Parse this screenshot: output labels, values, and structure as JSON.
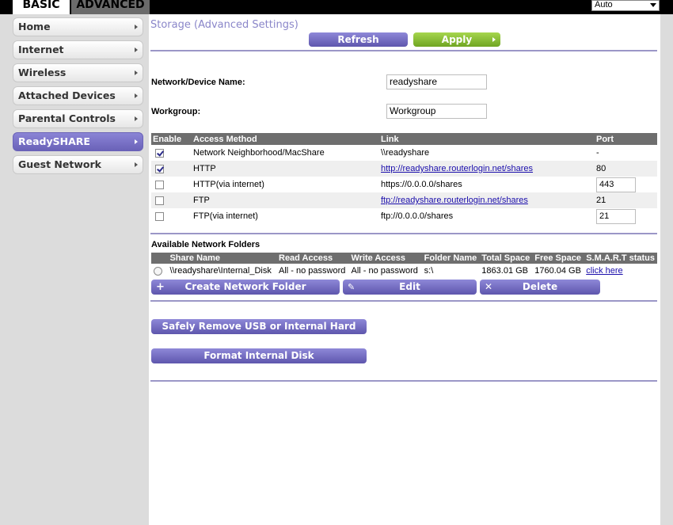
{
  "tabs": {
    "basic": "BASIC",
    "advanced": "ADVANCED"
  },
  "language": {
    "selected": "Auto"
  },
  "sidebar": {
    "items": [
      {
        "label": "Home"
      },
      {
        "label": "Internet"
      },
      {
        "label": "Wireless"
      },
      {
        "label": "Attached Devices"
      },
      {
        "label": "Parental Controls"
      },
      {
        "label": "ReadySHARE",
        "active": true
      },
      {
        "label": "Guest Network"
      }
    ]
  },
  "page": {
    "title": "Storage (Advanced Settings)"
  },
  "toolbar": {
    "refresh_label": "Refresh",
    "apply_label": "Apply"
  },
  "form": {
    "device_name_label": "Network/Device Name:",
    "device_name_value": "readyshare",
    "workgroup_label": "Workgroup:",
    "workgroup_value": "Workgroup"
  },
  "access_table": {
    "headers": [
      "Enable",
      "Access Method",
      "Link",
      "Port"
    ],
    "rows": [
      {
        "checked": true,
        "method": "Network Neighborhood/MacShare",
        "link": "\\\\readyshare",
        "link_is_url": false,
        "port": "-",
        "port_editable": false
      },
      {
        "checked": true,
        "method": "HTTP",
        "link": "http://readyshare.routerlogin.net/shares",
        "link_is_url": true,
        "port": "80",
        "port_editable": false
      },
      {
        "checked": false,
        "method": "HTTP(via internet)",
        "link": "https://0.0.0.0/shares",
        "link_is_url": false,
        "port": "443",
        "port_editable": true
      },
      {
        "checked": false,
        "method": "FTP",
        "link": "ftp://readyshare.routerlogin.net/shares",
        "link_is_url": true,
        "port": "21",
        "port_editable": false
      },
      {
        "checked": false,
        "method": "FTP(via internet)",
        "link": "ftp://0.0.0.0/shares",
        "link_is_url": false,
        "port": "21",
        "port_editable": true
      }
    ]
  },
  "folders": {
    "title": "Available Network Folders",
    "headers": [
      "Share Name",
      "Read Access",
      "Write Access",
      "Folder Name",
      "Total Space",
      "Free Space",
      "S.M.A.R.T status"
    ],
    "rows": [
      {
        "share_name": "\\\\readyshare\\Internal_Disk",
        "read_access": "All - no password",
        "write_access": "All - no password",
        "folder_name": "s:\\",
        "total_space": "1863.01 GB",
        "free_space": "1760.04 GB",
        "smart_status": "click here"
      }
    ],
    "create_label": "Create Network Folder",
    "edit_label": "Edit",
    "delete_label": "Delete"
  },
  "actions": {
    "safely_remove_label": "Safely Remove USB or Internal Hard Drive",
    "format_label": "Format Internal Disk"
  },
  "colors": {
    "accent": "#7169c4",
    "apply": "#8dc63f",
    "header_gray": "#6e6e6e"
  }
}
